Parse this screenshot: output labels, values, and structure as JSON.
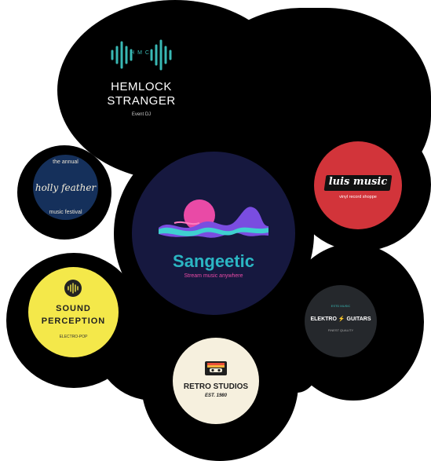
{
  "hemlock": {
    "monogram": "HMC",
    "line1": "HEMLOCK",
    "line2": "STRANGER",
    "tagline": "Event DJ"
  },
  "holly": {
    "top": "the annual",
    "name": "holly feather",
    "bottom": "music festival"
  },
  "sangeetic": {
    "name": "Sangeetic",
    "tagline": "Stream music anywhere"
  },
  "luis": {
    "name": "luis music",
    "tagline": "vinyl record shoppe"
  },
  "sound": {
    "line1": "SOUND",
    "line2": "PERCEPTION",
    "tagline": "ELECTRO-POP"
  },
  "elektro": {
    "top": "ESTD MUSIC",
    "left": "ELEKTRO",
    "right": "GUITARS",
    "bottom": "FINEST QUALITY"
  },
  "retro": {
    "name": "RETRO STUDIOS",
    "est": "EST. 1980"
  },
  "colors": {
    "teal": "#39b8b4",
    "navy_dark": "#16183f",
    "navy": "#15305b",
    "red": "#d2343a",
    "yellow": "#f4e84a",
    "cream": "#f6f0de",
    "charcoal": "#25282c",
    "sangeetic_text": "#2bb6c3"
  }
}
